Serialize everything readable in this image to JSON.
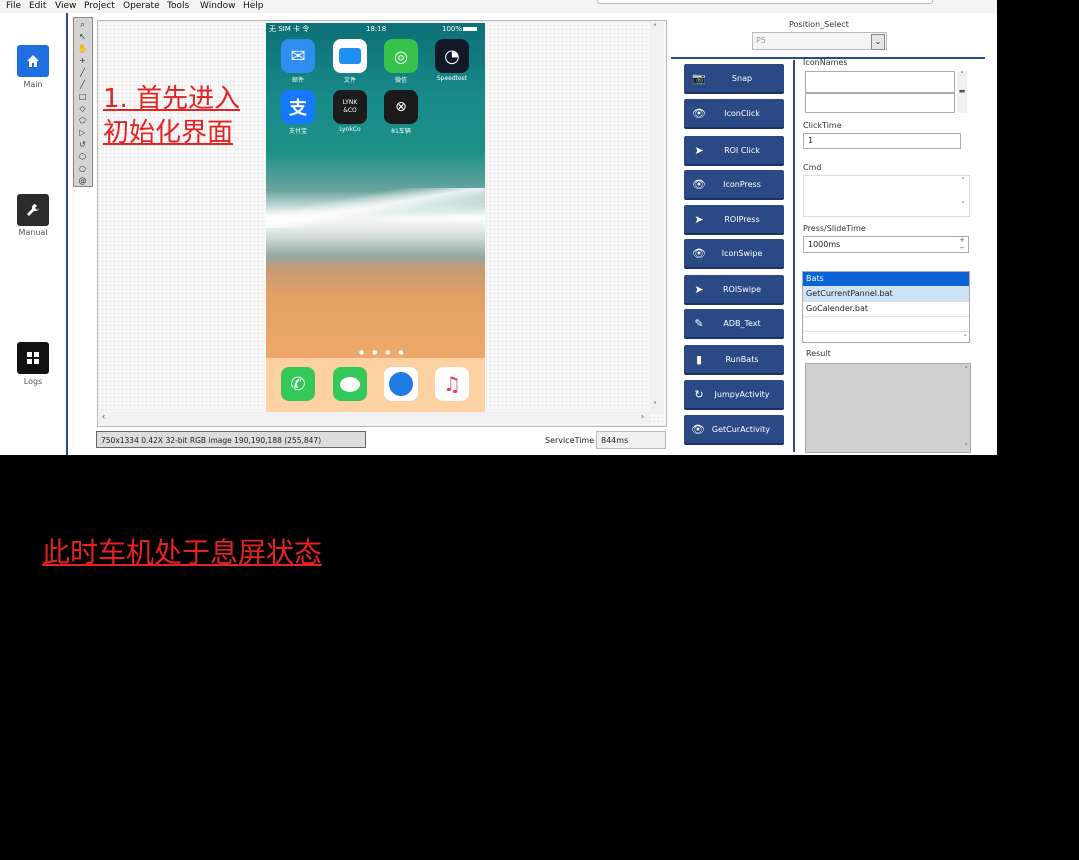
{
  "menu": [
    "File",
    "Edit",
    "View",
    "Project",
    "Operate",
    "Tools",
    "Window",
    "Help"
  ],
  "nav": [
    {
      "label": "Main",
      "icon": "home-icon",
      "color": "#1f6fe0"
    },
    {
      "label": "Manual",
      "icon": "wrench-icon",
      "color": "#2b2b2b"
    },
    {
      "label": "Logs",
      "icon": "grid-icon",
      "color": "#111111"
    }
  ],
  "annotation_top": "1. 首先进入\n初始化界面",
  "annotation_bottom": "此时车机处于息屏状态",
  "phone": {
    "status_left": "无 SIM 卡 令",
    "status_time": "18:18",
    "status_right": "100%",
    "apps": [
      {
        "label": "邮件",
        "color": "#2f8cf0",
        "glyph": "✉"
      },
      {
        "label": "文件",
        "color": "#1f8ff2",
        "glyph": "▬"
      },
      {
        "label": "微信",
        "color": "#37c24b",
        "glyph": "◎"
      },
      {
        "label": "Speedtest",
        "color": "#111827",
        "glyph": "◔"
      },
      {
        "label": "支付宝",
        "color": "#1677ff",
        "glyph": "支"
      },
      {
        "label": "LynkCo",
        "color": "#1c1c1c",
        "glyph": "LYNK &CO"
      },
      {
        "label": "81车辆",
        "color": "#1a1a1a",
        "glyph": "⊗"
      }
    ],
    "dock": [
      {
        "name": "phone",
        "color": "#34c759",
        "glyph": "✆"
      },
      {
        "name": "messages",
        "color": "#34c759",
        "glyph": "💬"
      },
      {
        "name": "safari",
        "color": "#ffffff",
        "glyph": "⊕"
      },
      {
        "name": "music",
        "color": "#ffffff",
        "glyph": "♫"
      }
    ]
  },
  "status": {
    "image_info": "750x1334 0.42X 32-bit RGB image 190,190,188    (255,847)",
    "service_label": "ServiceTime",
    "service_value": "844ms"
  },
  "position_select": {
    "label": "Position_Select",
    "value": "P5"
  },
  "actions": [
    {
      "label": "Snap",
      "icon": "camera-icon",
      "glyph": "📷"
    },
    {
      "label": "IconClick",
      "icon": "eye-icon",
      "glyph": "👁"
    },
    {
      "label": "ROI Click",
      "icon": "cursor-icon",
      "glyph": "➤"
    },
    {
      "label": "IconPress",
      "icon": "eye-icon",
      "glyph": "👁"
    },
    {
      "label": "ROIPress",
      "icon": "cursor-icon",
      "glyph": "➤"
    },
    {
      "label": "IconSwipe",
      "icon": "eye-icon",
      "glyph": "👁"
    },
    {
      "label": "ROISwipe",
      "icon": "cursor-icon",
      "glyph": "➤"
    },
    {
      "label": "ADB_Text",
      "icon": "pencil-icon",
      "glyph": "✎"
    },
    {
      "label": "RunBats",
      "icon": "sdcard-icon",
      "glyph": "▮"
    },
    {
      "label": "JumpyActivity",
      "icon": "refresh-icon",
      "glyph": "↻"
    },
    {
      "label": "GetCurActivity",
      "icon": "eye-icon",
      "glyph": "👁"
    }
  ],
  "right_panel": {
    "icon_names_label": "IconNames",
    "click_time_label": "ClickTime",
    "click_time_value": "1",
    "cmd_label": "Cmd",
    "press_time_label": "Press/SlideTime",
    "press_time_value": "1000ms",
    "bats": [
      "Bats",
      "GetCurrentPannel.bat",
      "GoCalender.bat"
    ],
    "result_label": "Result"
  }
}
